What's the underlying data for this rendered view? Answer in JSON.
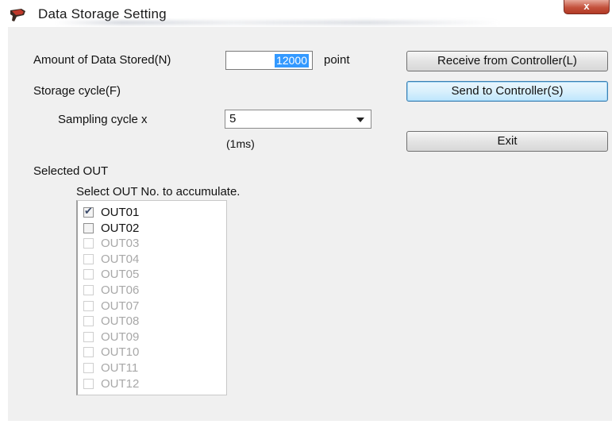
{
  "window": {
    "title": "Data Storage Setting",
    "close_glyph": "x",
    "icon": "app-icon"
  },
  "form": {
    "amount_label": "Amount of Data Stored(N)",
    "amount_value": "12000",
    "amount_unit": "point",
    "storage_cycle_label": "Storage cycle(F)",
    "sampling_label": "Sampling cycle x",
    "sampling_value": "5",
    "sampling_unit": "(1ms)"
  },
  "buttons": {
    "receive": "Receive from Controller(L)",
    "send": "Send to Controller(S)",
    "exit": "Exit"
  },
  "selected_out": {
    "label": "Selected OUT",
    "hint": "Select OUT No. to accumulate.",
    "items": [
      {
        "label": "OUT01",
        "checked": true,
        "enabled": true
      },
      {
        "label": "OUT02",
        "checked": false,
        "enabled": true
      },
      {
        "label": "OUT03",
        "checked": false,
        "enabled": false
      },
      {
        "label": "OUT04",
        "checked": false,
        "enabled": false
      },
      {
        "label": "OUT05",
        "checked": false,
        "enabled": false
      },
      {
        "label": "OUT06",
        "checked": false,
        "enabled": false
      },
      {
        "label": "OUT07",
        "checked": false,
        "enabled": false
      },
      {
        "label": "OUT08",
        "checked": false,
        "enabled": false
      },
      {
        "label": "OUT09",
        "checked": false,
        "enabled": false
      },
      {
        "label": "OUT10",
        "checked": false,
        "enabled": false
      },
      {
        "label": "OUT11",
        "checked": false,
        "enabled": false
      },
      {
        "label": "OUT12",
        "checked": false,
        "enabled": false
      }
    ]
  },
  "colors": {
    "selection": "#3399ff",
    "disabled_text": "#a8a8a8",
    "dialog_bg": "#f0f0f0"
  }
}
